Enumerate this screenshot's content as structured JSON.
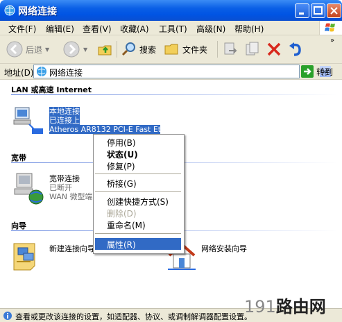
{
  "window": {
    "title": "网络连接"
  },
  "menu": [
    "文件(F)",
    "编辑(E)",
    "查看(V)",
    "收藏(A)",
    "工具(T)",
    "高级(N)",
    "帮助(H)"
  ],
  "toolbar": {
    "back": "后退",
    "search": "搜索",
    "folders": "文件夹"
  },
  "address": {
    "label": "地址(D)",
    "value": "网络连接",
    "go": "转到"
  },
  "groups": {
    "lan": "LAN 或高速 Internet",
    "broadband": "宽带",
    "wizard": "向导"
  },
  "lan_conn": {
    "name": "本地连接",
    "status": "已连接上",
    "device": "Atheros AR8132 PCI-E Fast Et..."
  },
  "bb_conn": {
    "name": "宽带连接",
    "status": "已断开",
    "device": "WAN 微型端"
  },
  "wizard_items": {
    "new_conn": "新建连接向导",
    "home_net": "网络安装向导"
  },
  "context_menu": {
    "disable": "停用(B)",
    "status": "状态(U)",
    "repair": "修复(P)",
    "bridge": "桥接(G)",
    "shortcut": "创建快捷方式(S)",
    "delete": "删除(D)",
    "rename": "重命名(M)",
    "properties": "属性(R)"
  },
  "statusbar": {
    "text": "查看或更改该连接的设置，如适配器、协议、或调制解调器配置设置。"
  },
  "watermark": {
    "prefix": "191",
    "suffix": "路由网"
  },
  "colors": {
    "titlebar": "#0054e3",
    "selection": "#316ac5",
    "chrome": "#ece9d8"
  }
}
